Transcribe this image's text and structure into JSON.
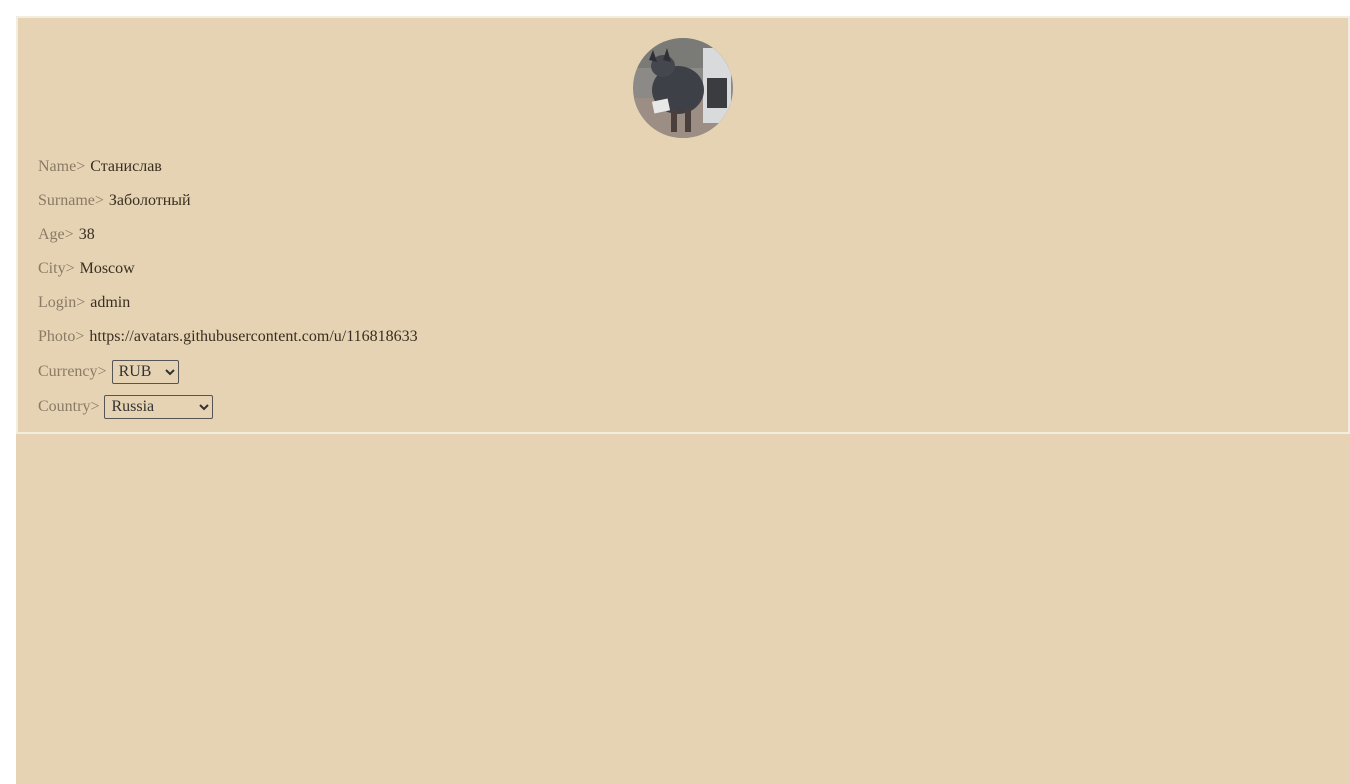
{
  "profile": {
    "avatar_alt": "avatar",
    "fields": {
      "name": {
        "label": "Name>",
        "value": "Станислав"
      },
      "surname": {
        "label": "Surname>",
        "value": "Заболотный"
      },
      "age": {
        "label": "Age>",
        "value": "38"
      },
      "city": {
        "label": "City>",
        "value": "Moscow"
      },
      "login": {
        "label": "Login>",
        "value": "admin"
      },
      "photo": {
        "label": "Photo>",
        "value": "https://avatars.githubusercontent.com/u/116818633"
      }
    },
    "currency": {
      "label": "Currency>",
      "selected": "RUB"
    },
    "country": {
      "label": "Country>",
      "selected": "Russia"
    }
  },
  "colors": {
    "background": "#e5d3b3",
    "label": "#8a7a66",
    "value": "#3a2e22"
  }
}
